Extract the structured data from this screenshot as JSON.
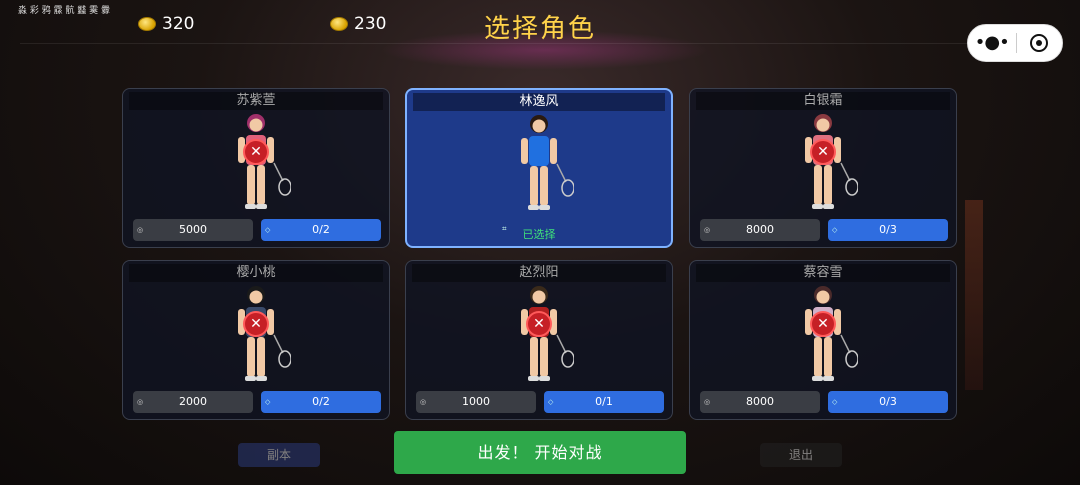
{
  "header": {
    "sys_text": "淼 彩 鸦 霡 骯 蠽 霙 釁",
    "coins": [
      {
        "value": "320"
      },
      {
        "value": "230"
      }
    ],
    "title": "选择角色",
    "capsule": {
      "more_icon": "more-dots-icon",
      "close_icon": "target-icon"
    }
  },
  "characters": [
    {
      "name": "苏紫萱",
      "price": "5000",
      "progress": "0/2",
      "locked": true,
      "selected": false,
      "outfit": "#e0607a",
      "hair": "#a0306a"
    },
    {
      "name": "林逸风",
      "price": "",
      "progress": "",
      "locked": false,
      "selected": true,
      "status": "已选择",
      "outfit": "#2070e0",
      "hair": "#2a1a10"
    },
    {
      "name": "白银霜",
      "price": "8000",
      "progress": "0/3",
      "locked": true,
      "selected": false,
      "outfit": "#e07080",
      "hair": "#8a3a40"
    },
    {
      "name": "樱小桃",
      "price": "2000",
      "progress": "0/2",
      "locked": true,
      "selected": false,
      "outfit": "#3a4a6a",
      "hair": "#1a1a1a"
    },
    {
      "name": "赵烈阳",
      "price": "1000",
      "progress": "0/1",
      "locked": true,
      "selected": false,
      "outfit": "#b02020",
      "hair": "#3a2a1a"
    },
    {
      "name": "蔡容雪",
      "price": "8000",
      "progress": "0/3",
      "locked": true,
      "selected": false,
      "outfit": "#d0b0c8",
      "hair": "#4a2a2a"
    }
  ],
  "start_button": "出发！ 开始对战",
  "bottom_deco": {
    "left": "副本",
    "right": "退出"
  },
  "colors": {
    "title": "#ffd34a",
    "selected_card": "#1e3a8a",
    "progress_button": "#2f6de0",
    "start_button": "#2ea84a",
    "lock": "#c62026"
  }
}
